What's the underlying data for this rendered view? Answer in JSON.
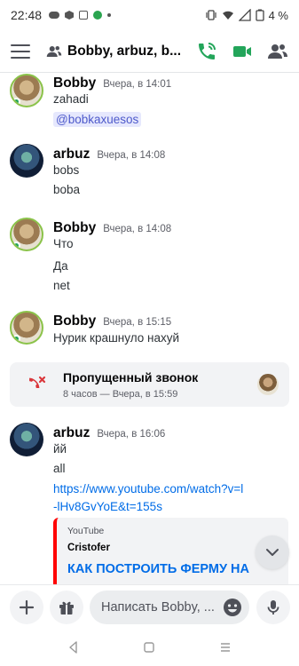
{
  "status_bar": {
    "time": "22:48",
    "battery": "4 %",
    "icons": [
      "discord-icon",
      "hex-icon",
      "square-icon",
      "green-app-icon",
      "notification-dot"
    ]
  },
  "header": {
    "title": "Bobby, arbuz, b...",
    "icons": [
      "hamburger-icon",
      "group-icon",
      "voice-call-icon",
      "video-call-icon",
      "members-icon"
    ]
  },
  "messages": [
    {
      "author": "Bobby",
      "timestamp": "Вчера, в 14:01",
      "lines": [
        "zahadi"
      ],
      "mention": "@bobkaxuesos"
    },
    {
      "author": "arbuz",
      "timestamp": "Вчера, в 14:08",
      "lines": [
        "bobs",
        "boba"
      ]
    },
    {
      "author": "Bobby",
      "timestamp": "Вчера, в 14:08",
      "lines": [
        "Что",
        "Да",
        "net"
      ]
    },
    {
      "author": "Bobby",
      "timestamp": "Вчера, в 15:15",
      "lines": [
        "Нурик крашнуло нахуй"
      ]
    },
    {
      "author": "arbuz",
      "timestamp": "Вчера, в 16:06",
      "lines": [
        "йй",
        "all"
      ],
      "link_1": "https://www.youtube.com/watch?v=l",
      "link_2": "-lHv8GvYoE&t=155s"
    }
  ],
  "missed_call": {
    "title": "Пропущенный звонок",
    "subtitle": "8 часов — Вчера, в 15:59"
  },
  "embed": {
    "provider": "YouTube",
    "channel": "Cristofer",
    "title": "КАК ПОСТРОИТЬ ФЕРМУ НА"
  },
  "composer": {
    "placeholder": "Написать Bobby, ..."
  },
  "colors": {
    "accent_green": "#23a55a",
    "link_blue": "#006ce7",
    "missed_call_red": "#da373c",
    "youtube_red": "#ff0000"
  }
}
